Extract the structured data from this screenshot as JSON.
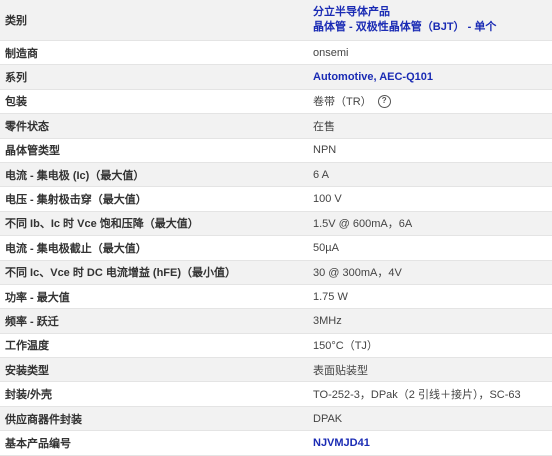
{
  "rows": [
    {
      "label": "类别",
      "lines": [
        "分立半导体产品",
        "晶体管 - 双极性晶体管（BJT） - 单个"
      ]
    },
    {
      "label": "制造商",
      "value": "onsemi"
    },
    {
      "label": "系列",
      "value": "Automotive, AEC-Q101"
    },
    {
      "label": "包装",
      "value": "卷带（TR）",
      "icon": "help-circle-icon"
    },
    {
      "label": "零件状态",
      "value": "在售"
    },
    {
      "label": "晶体管类型",
      "value": "NPN"
    },
    {
      "label": "电流 - 集电极 (Ic)（最大值）",
      "value": "6 A"
    },
    {
      "label": "电压 - 集射极击穿（最大值）",
      "value": "100 V"
    },
    {
      "label": "不同 Ib、Ic 时 Vce 饱和压降（最大值）",
      "value": "1.5V @ 600mA，6A"
    },
    {
      "label": "电流 - 集电极截止（最大值）",
      "value": "50µA"
    },
    {
      "label": "不同 Ic、Vce 时 DC 电流增益 (hFE)（最小值）",
      "value": "30 @ 300mA，4V"
    },
    {
      "label": "功率 - 最大值",
      "value": "1.75 W"
    },
    {
      "label": "频率 - 跃迁",
      "value": "3MHz"
    },
    {
      "label": "工作温度",
      "value": "150°C（TJ）"
    },
    {
      "label": "安装类型",
      "value": "表面贴装型"
    },
    {
      "label": "封装/外壳",
      "value": "TO-252-3，DPak（2 引线＋接片），SC-63"
    },
    {
      "label": "供应商器件封装",
      "value": "DPAK"
    },
    {
      "label": "基本产品编号",
      "value": "NJVMJD41"
    }
  ],
  "help_glyph": "?"
}
